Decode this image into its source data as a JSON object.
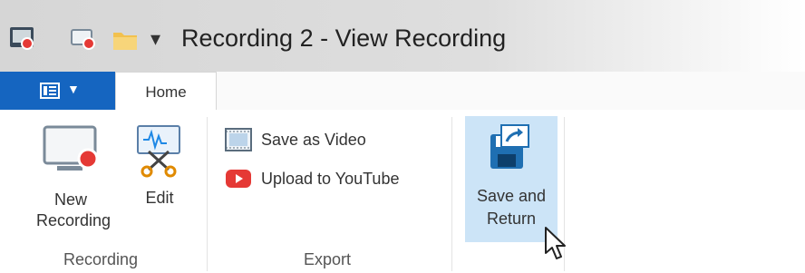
{
  "window": {
    "title": "Recording 2 - View Recording",
    "quick_access_more": "▾"
  },
  "tabs": [
    {
      "label": "Home",
      "active": true
    }
  ],
  "ribbon": {
    "groups": [
      {
        "label": "Recording",
        "buttons": [
          {
            "label_line1": "New",
            "label_line2": "Recording",
            "icon": "new-recording-icon"
          },
          {
            "label_line1": "Edit",
            "icon": "edit-scissors-icon"
          }
        ]
      },
      {
        "label": "Export",
        "buttons": [
          {
            "label": "Save as Video",
            "icon": "film-icon"
          },
          {
            "label": "Upload to YouTube",
            "icon": "youtube-icon"
          }
        ]
      },
      {
        "label": "",
        "buttons": [
          {
            "label_line1": "Save and",
            "label_line2": "Return",
            "icon": "save-return-icon",
            "hovered": true
          }
        ]
      }
    ]
  },
  "colors": {
    "accent": "#1565c0",
    "hover": "#cce4f7",
    "record_red": "#e53935"
  }
}
